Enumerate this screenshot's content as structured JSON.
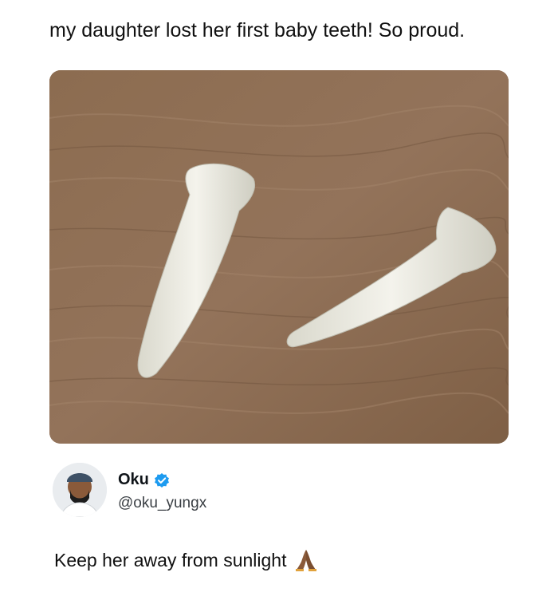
{
  "post": {
    "text": "my daughter lost her first baby teeth! So proud.",
    "image_icon": "photo-of-two-teeth-on-wooden-table"
  },
  "reply": {
    "display_name": "Oku",
    "handle": "@oku_yungx",
    "verified": true,
    "text": "Keep her away from sunlight",
    "emoji_icon": "folded-hands-icon",
    "avatar_icon": "avatar"
  },
  "colors": {
    "verified_blue": "#1d9bf0",
    "text": "#111111",
    "wood": "#8a6a4e"
  }
}
